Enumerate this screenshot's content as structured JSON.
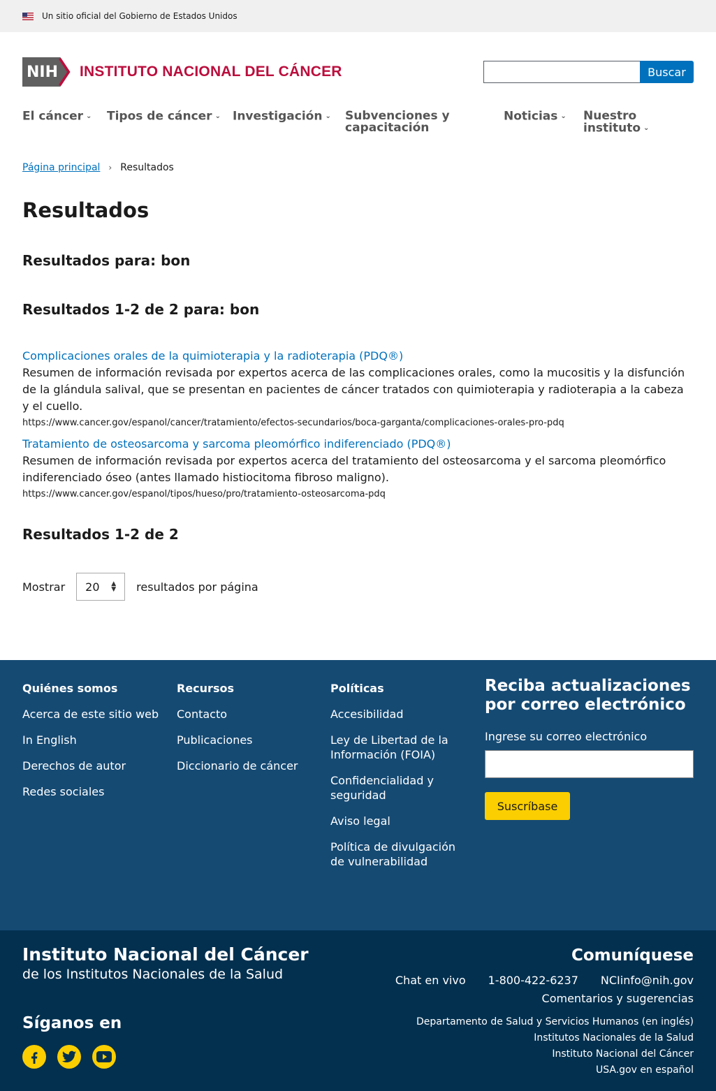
{
  "gov_banner": {
    "text": "Un sitio oficial del Gobierno de Estados Unidos"
  },
  "header": {
    "nih_text": "NIH",
    "logo_text": "INSTITUTO NACIONAL DEL CÁNCER",
    "search_placeholder": "",
    "search_button": "Buscar"
  },
  "nav": [
    {
      "label": "El cáncer",
      "has_dropdown": true
    },
    {
      "label": "Tipos de cáncer",
      "has_dropdown": true
    },
    {
      "label": "Investigación",
      "has_dropdown": true
    },
    {
      "label": "Subvenciones y",
      "label2": "capacitación",
      "has_dropdown": false
    },
    {
      "label": "Noticias",
      "has_dropdown": true
    },
    {
      "label": "Nuestro instituto",
      "has_dropdown": true
    }
  ],
  "breadcrumb": {
    "home": "Página principal",
    "current": "Resultados"
  },
  "page_title": "Resultados",
  "results_for": "Resultados para: bon",
  "results_range": "Resultados 1-2 de 2 para: bon",
  "results": [
    {
      "title": "Complicaciones orales de la quimioterapia y la radioterapia (PDQ®)",
      "description": "Resumen de información revisada por expertos acerca de las complicaciones orales, como la mucositis y la disfunción de la glándula salival, que se presentan en pacientes de cáncer tratados con quimioterapia y radioterapia a la cabeza y el cuello.",
      "url": "https://www.cancer.gov/espanol/cancer/tratamiento/efectos-secundarios/boca-garganta/complicaciones-orales-pro-pdq"
    },
    {
      "title": "Tratamiento de osteosarcoma y sarcoma pleomórfico indiferenciado (PDQ®)",
      "description": "Resumen de información revisada por expertos acerca del tratamiento del osteosarcoma y el sarcoma pleomórfico indiferenciado óseo (antes llamado histiocitoma fibroso maligno).",
      "url": "https://www.cancer.gov/espanol/tipos/hueso/pro/tratamiento-osteosarcoma-pdq"
    }
  ],
  "results_total": "Resultados 1-2 de 2",
  "per_page": {
    "label_before": "Mostrar",
    "value": "20",
    "label_after": "resultados por página"
  },
  "footer": {
    "columns": [
      {
        "title": "Quiénes somos",
        "links": [
          "Acerca de este sitio web",
          "In English",
          "Derechos de autor",
          "Redes sociales"
        ]
      },
      {
        "title": "Recursos",
        "links": [
          "Contacto",
          "Publicaciones",
          "Diccionario de cáncer"
        ]
      },
      {
        "title": "Políticas",
        "links": [
          "Accesibilidad",
          "Ley de Libertad de la Información (FOIA)",
          "Confidencialidad y seguridad",
          "Aviso legal",
          "Política de divulgación de vulnerabilidad"
        ]
      }
    ],
    "signup": {
      "title": "Reciba actualizaciones por correo electrónico",
      "label": "Ingrese su correo electrónico",
      "button": "Suscríbase"
    },
    "bottom": {
      "title": "Instituto Nacional del Cáncer",
      "subtitle": "de los Institutos Nacionales de la Salud",
      "follow": "Síganos en",
      "social": [
        "facebook-icon",
        "twitter-icon",
        "youtube-icon"
      ],
      "contact_title": "Comuníquese",
      "chat": "Chat en vivo",
      "phone": "1-800-422-6237",
      "email": "NCIinfo@nih.gov",
      "feedback": "Comentarios y sugerencias",
      "gov_links": [
        "Departamento de Salud y Servicios Humanos (en inglés)",
        "Institutos Nacionales de la Salud",
        "Instituto Nacional del Cáncer",
        "USA.gov en español"
      ]
    }
  },
  "colors": {
    "link": "#0071bc",
    "brand_red": "#bb0e3d",
    "footer_top": "#154a73",
    "footer_bottom": "#03304f",
    "accent_yellow": "#face00"
  }
}
